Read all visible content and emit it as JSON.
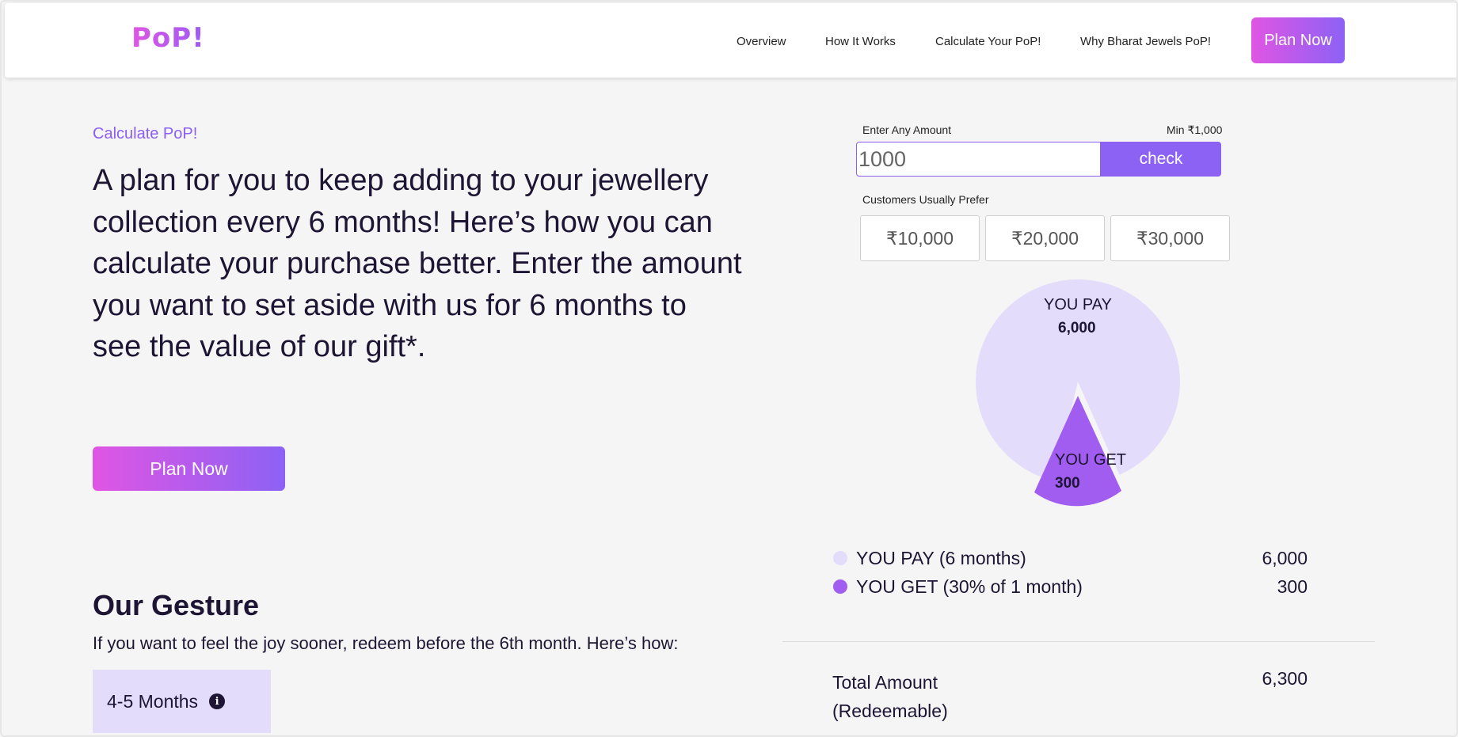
{
  "header": {
    "logo": "PoP!",
    "nav": [
      "Overview",
      "How It Works",
      "Calculate Your PoP!",
      "Why Bharat Jewels PoP!"
    ],
    "cta_label": "Plan Now"
  },
  "intro": {
    "eyebrow": "Calculate PoP!",
    "headline": "A plan for you to keep adding to your jewellery collection every 6 months! Here’s how you can calculate your purchase better. Enter the amount you want to set aside with us for 6 months to see the value of our gift*.",
    "cta_label": "Plan Now"
  },
  "gesture": {
    "title": "Our Gesture",
    "description": "If you want to feel the joy sooner, redeem before the 6th month. Here’s how:",
    "tab_label": "4-5 Months"
  },
  "calculator": {
    "amount_label": "Enter Any Amount",
    "min_label": "Min ₹1,000",
    "amount_placeholder": "1000",
    "check_label": "check",
    "prefer_label": "Customers Usually Prefer",
    "presets": [
      "₹10,000",
      "₹20,000",
      "₹30,000"
    ]
  },
  "pie": {
    "pay_title": "YOU PAY",
    "pay_value": "6,000",
    "get_title": "YOU GET",
    "get_value": "300",
    "pay_color": "#e4dcfb",
    "get_color": "#a05df0"
  },
  "summary": {
    "pay_label": "YOU PAY (6 months)",
    "pay_value": "6,000",
    "get_label": "YOU GET (30% of 1 month)",
    "get_value": "300",
    "total_label_line1": "Total Amount",
    "total_label_line2": "(Redeemable)",
    "total_value": "6,300"
  }
}
